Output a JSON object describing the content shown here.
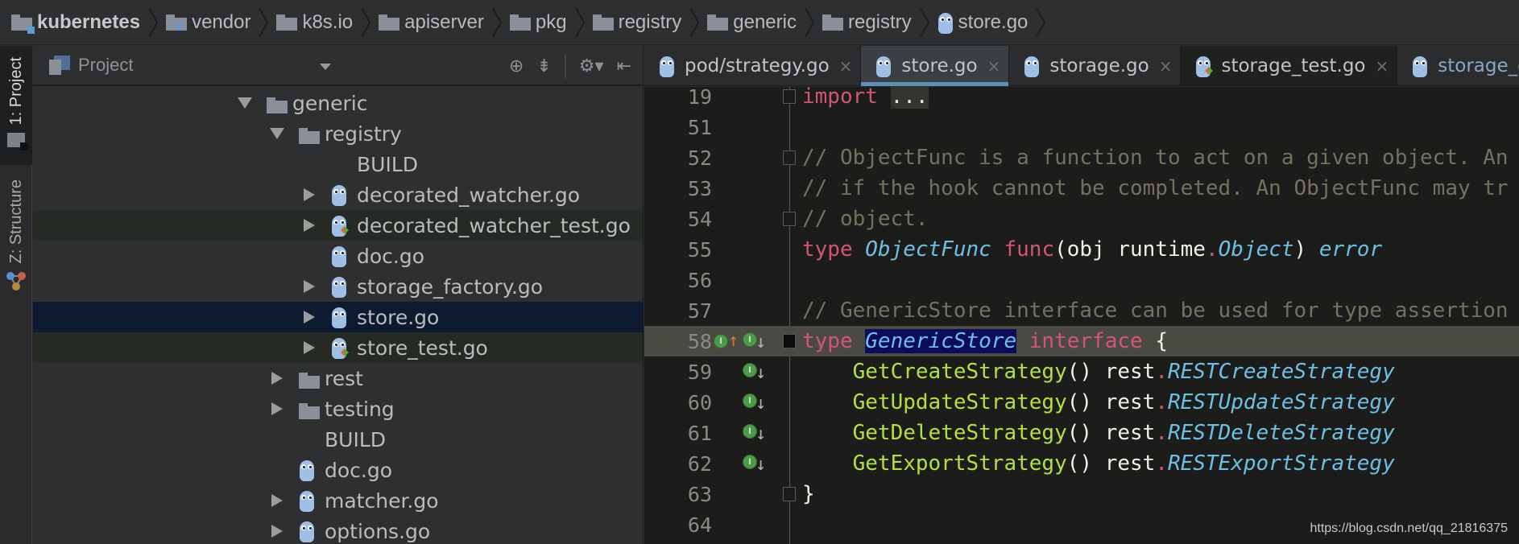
{
  "breadcrumb": [
    {
      "label": "kubernetes",
      "icon": "module-folder-icon"
    },
    {
      "label": "vendor",
      "icon": "vendor-folder-icon"
    },
    {
      "label": "k8s.io",
      "icon": "folder-icon"
    },
    {
      "label": "apiserver",
      "icon": "folder-icon"
    },
    {
      "label": "pkg",
      "icon": "folder-icon"
    },
    {
      "label": "registry",
      "icon": "folder-icon"
    },
    {
      "label": "generic",
      "icon": "folder-icon"
    },
    {
      "label": "registry",
      "icon": "folder-icon"
    },
    {
      "label": "store.go",
      "icon": "go-file-icon"
    }
  ],
  "toolstrip": {
    "project_tab": "1: Project",
    "structure_tab": "Z: Structure"
  },
  "project_panel": {
    "title": "Project",
    "tools": [
      "locate-icon",
      "collapse-all-icon",
      "settings-icon",
      "hide-panel-icon"
    ],
    "tree": [
      {
        "label": "generic",
        "type": "folder",
        "expanded": true,
        "depth": 0
      },
      {
        "label": "registry",
        "type": "folder",
        "expanded": true,
        "depth": 1
      },
      {
        "label": "BUILD",
        "type": "file",
        "depth": 2
      },
      {
        "label": "decorated_watcher.go",
        "type": "go",
        "expandable": true,
        "depth": 2
      },
      {
        "label": "decorated_watcher_test.go",
        "type": "go-test",
        "expandable": true,
        "depth": 2
      },
      {
        "label": "doc.go",
        "type": "go",
        "depth": 2
      },
      {
        "label": "storage_factory.go",
        "type": "go",
        "expandable": true,
        "depth": 2
      },
      {
        "label": "store.go",
        "type": "go",
        "expandable": true,
        "depth": 2,
        "selected": true
      },
      {
        "label": "store_test.go",
        "type": "go-test",
        "expandable": true,
        "depth": 2
      },
      {
        "label": "rest",
        "type": "folder",
        "expandable": true,
        "depth": 1
      },
      {
        "label": "testing",
        "type": "folder",
        "expandable": true,
        "depth": 1
      },
      {
        "label": "BUILD",
        "type": "file",
        "depth": 1
      },
      {
        "label": "doc.go",
        "type": "go",
        "depth": 1
      },
      {
        "label": "matcher.go",
        "type": "go",
        "expandable": true,
        "depth": 1
      },
      {
        "label": "options.go",
        "type": "go",
        "expandable": true,
        "depth": 1
      }
    ]
  },
  "tabs": [
    {
      "label": "pod/strategy.go",
      "active": false,
      "test": false
    },
    {
      "label": "store.go",
      "active": true,
      "test": false
    },
    {
      "label": "storage.go",
      "active": false,
      "test": false
    },
    {
      "label": "storage_test.go",
      "active": false,
      "test": true
    },
    {
      "label": "storage_co",
      "active": false,
      "test": false,
      "partial": true
    }
  ],
  "tab_close_glyph": "×",
  "editor": {
    "lines": [
      {
        "n": "19",
        "tokens": [
          [
            "kw",
            "import"
          ],
          [
            "pl",
            " "
          ],
          [
            "dots",
            "..."
          ]
        ]
      },
      {
        "n": "51",
        "tokens": []
      },
      {
        "n": "52",
        "tokens": [
          [
            "cm",
            "// ObjectFunc is a function to act on a given object. An"
          ]
        ]
      },
      {
        "n": "53",
        "tokens": [
          [
            "cm",
            "// if the hook cannot be completed. An ObjectFunc may tr"
          ]
        ]
      },
      {
        "n": "54",
        "tokens": [
          [
            "cm",
            "// object."
          ]
        ]
      },
      {
        "n": "55",
        "tokens": [
          [
            "kw",
            "type"
          ],
          [
            "pl",
            " "
          ],
          [
            "ty",
            "ObjectFunc"
          ],
          [
            "pl",
            " "
          ],
          [
            "kw",
            "func"
          ],
          [
            "pl",
            "(obj runtime"
          ],
          [
            "kw",
            "."
          ],
          [
            "ty",
            "Object"
          ],
          [
            "pl",
            ") "
          ],
          [
            "ty",
            "error"
          ]
        ]
      },
      {
        "n": "56",
        "tokens": []
      },
      {
        "n": "57",
        "tokens": [
          [
            "cm",
            "// GenericStore interface can be used for type assertion"
          ]
        ]
      },
      {
        "n": "58",
        "tokens": [
          [
            "kw",
            "type"
          ],
          [
            "pl",
            " "
          ],
          [
            "sel",
            "GenericStore"
          ],
          [
            "pl",
            " "
          ],
          [
            "kw",
            "interface"
          ],
          [
            "pl",
            " {"
          ]
        ],
        "current": true
      },
      {
        "n": "59",
        "tokens": [
          [
            "pl",
            "    "
          ],
          [
            "fn",
            "GetCreateStrategy"
          ],
          [
            "pl",
            "() rest"
          ],
          [
            "kw",
            "."
          ],
          [
            "ty",
            "RESTCreateStrategy"
          ]
        ]
      },
      {
        "n": "60",
        "tokens": [
          [
            "pl",
            "    "
          ],
          [
            "fn",
            "GetUpdateStrategy"
          ],
          [
            "pl",
            "() rest"
          ],
          [
            "kw",
            "."
          ],
          [
            "ty",
            "RESTUpdateStrategy"
          ]
        ]
      },
      {
        "n": "61",
        "tokens": [
          [
            "pl",
            "    "
          ],
          [
            "fn",
            "GetDeleteStrategy"
          ],
          [
            "pl",
            "() rest"
          ],
          [
            "kw",
            "."
          ],
          [
            "ty",
            "RESTDeleteStrategy"
          ]
        ]
      },
      {
        "n": "62",
        "tokens": [
          [
            "pl",
            "    "
          ],
          [
            "fn",
            "GetExportStrategy"
          ],
          [
            "pl",
            "() rest"
          ],
          [
            "kw",
            "."
          ],
          [
            "ty",
            "RESTExportStrategy"
          ]
        ]
      },
      {
        "n": "63",
        "tokens": [
          [
            "pl",
            "}"
          ]
        ]
      },
      {
        "n": "64",
        "tokens": []
      }
    ],
    "gutter_icon_letter": "I"
  },
  "watermark": "https://blog.csdn.net/qq_21816375"
}
